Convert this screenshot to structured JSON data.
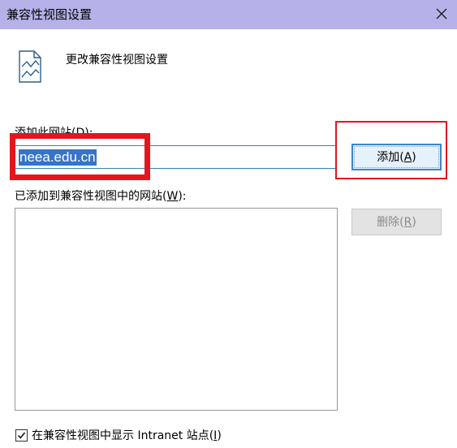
{
  "window": {
    "title": "兼容性视图设置",
    "close_glyph": "✕"
  },
  "header": {
    "icon": "document-chart-icon",
    "text": "更改兼容性视图设置"
  },
  "add_section": {
    "label_prefix": "添加此网站(",
    "label_key": "D",
    "label_suffix": "):",
    "input_value": "neea.edu.cn",
    "add_button_prefix": "添加(",
    "add_button_key": "A",
    "add_button_suffix": ")"
  },
  "list_section": {
    "label_prefix": "已添加到兼容性视图中的网站(",
    "label_key": "W",
    "label_suffix": "):",
    "items": [],
    "remove_button_prefix": "删除(",
    "remove_button_key": "R",
    "remove_button_suffix": ")"
  },
  "intranet_option": {
    "checked": true,
    "label_prefix": "在兼容性视图中显示 Intranet 站点(",
    "label_key": "I",
    "label_suffix": ")"
  },
  "colors": {
    "titlebar": "#b6b1e8",
    "selection": "#3574c8",
    "highlight": "#e5151c",
    "focus_border": "#3c84d0"
  }
}
